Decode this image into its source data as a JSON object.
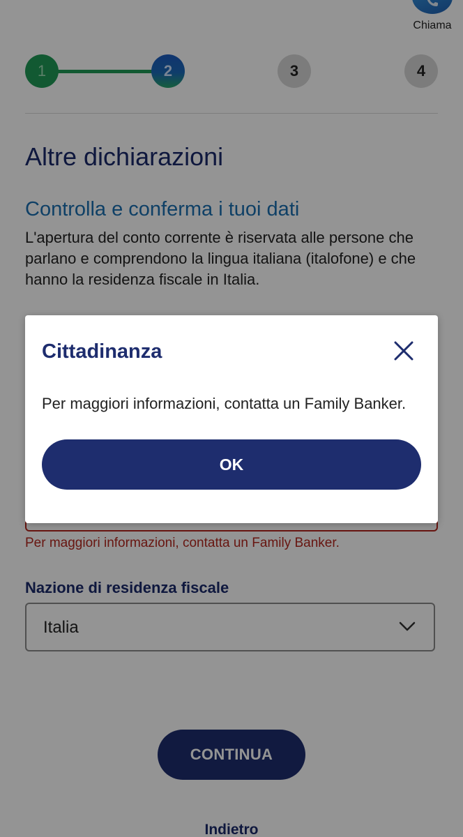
{
  "header": {
    "call_label": "Chiama",
    "call_icon": "phone-icon"
  },
  "stepper": {
    "steps": [
      {
        "label": "1",
        "state": "done"
      },
      {
        "label": "2",
        "state": "active"
      },
      {
        "label": "3",
        "state": "todo"
      },
      {
        "label": "4",
        "state": "todo"
      }
    ]
  },
  "main": {
    "title": "Altre dichiarazioni",
    "section_title": "Controlla e conferma i tuoi dati",
    "intro": "L'apertura del conto corrente è riservata alle persone che parlano e comprendono la lingua italiana (italofone) e che hanno la residenza fiscale in Italia.",
    "cittadinanza_error": "Per maggiori informazioni, contatta un Family Banker.",
    "residence_label": "Nazione di residenza fiscale",
    "residence_value": "Italia",
    "continue_label": "CONTINUA",
    "back_label": "Indietro"
  },
  "modal": {
    "title": "Cittadinanza",
    "text": "Per maggiori informazioni, contatta un Family Banker.",
    "ok_label": "OK"
  },
  "colors": {
    "brand_navy": "#1e2d6e",
    "accent_blue": "#1a6fb0",
    "success_green": "#1f9a57",
    "error_red": "#b3261e"
  }
}
